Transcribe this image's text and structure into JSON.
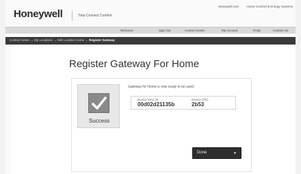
{
  "top_links": [
    "Honeywell.com",
    "Home Comfort & Energy Systems"
  ],
  "header": {
    "logo": "Honeywell",
    "tagline": "Total Connect Comfort"
  },
  "nav": {
    "items": [
      "Welcome",
      "Sign Out",
      "Control Center",
      "My Account",
      "FAQs",
      "Contact Us"
    ]
  },
  "breadcrumb": {
    "items": [
      "Control Center",
      "My Locations",
      "Edit Location Home"
    ],
    "current": "Register Gateway",
    "separator": "→"
  },
  "main": {
    "title": "Register Gateway For Home",
    "status_label": "Success",
    "status_icon": "checkmark-icon",
    "message": "Gateway for Home is now ready to be used.",
    "device": {
      "mac_label": "Device MAC ID",
      "mac_value": "00d02d21135b",
      "crc_label": "Device CRC",
      "crc_value": "2b53"
    },
    "done_button": "Done",
    "done_icon": "caret-down-icon"
  },
  "colors": {
    "breadcrumb_bar": "#3a3a3a",
    "button": "#2e2e2e",
    "success_icon_bg": "#8a8a8a"
  }
}
